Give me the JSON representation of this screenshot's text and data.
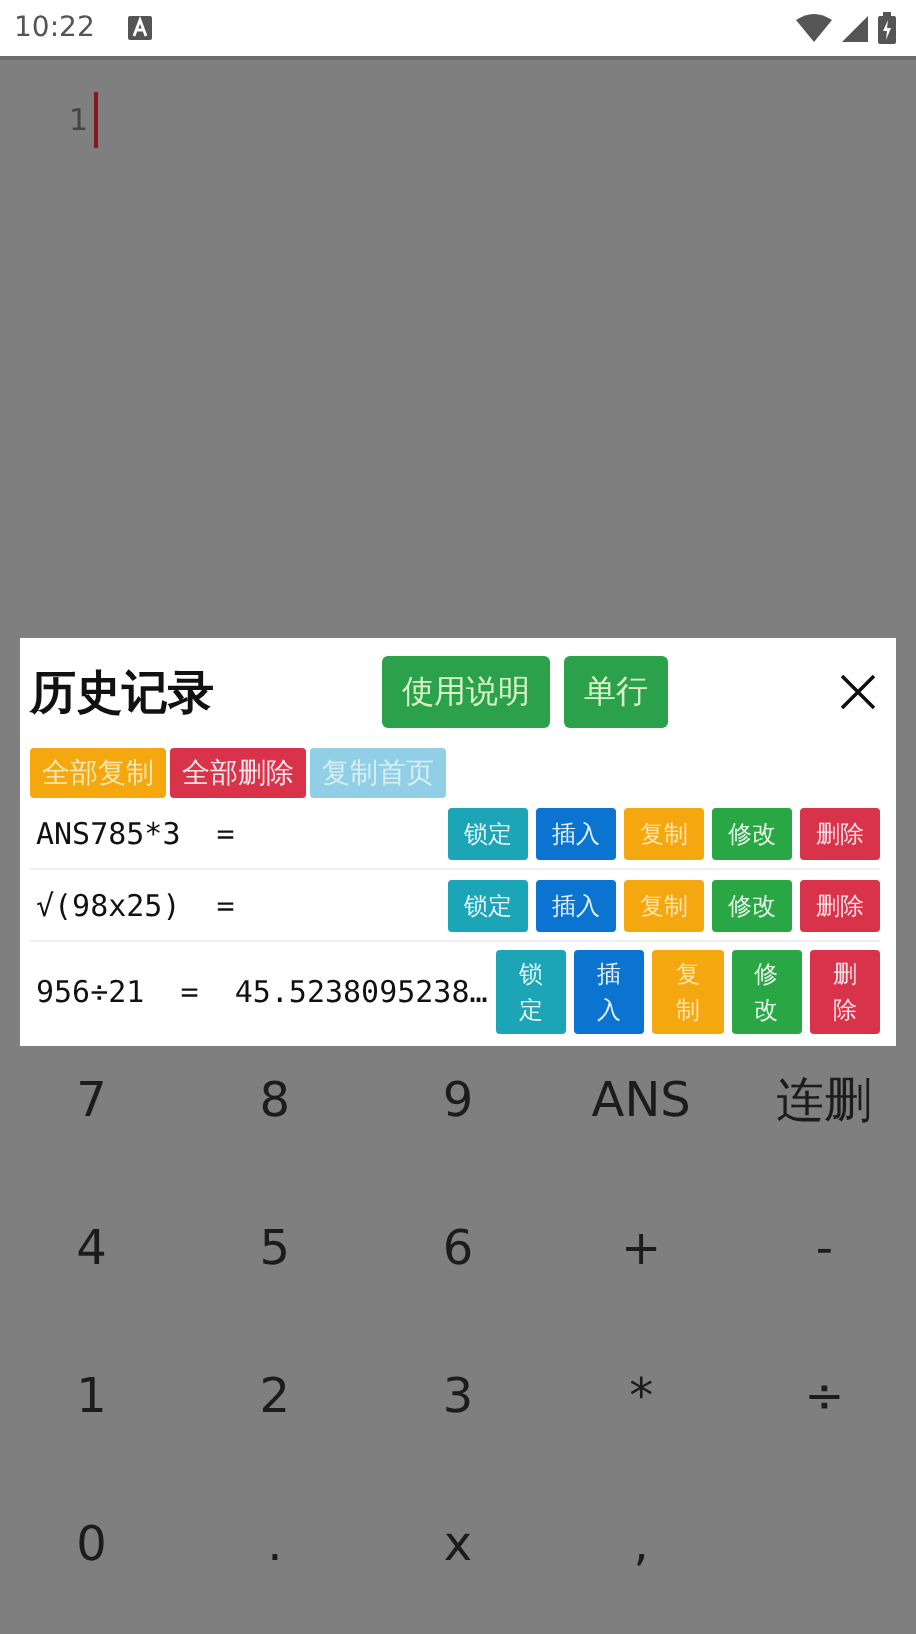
{
  "status_bar": {
    "time": "10:22"
  },
  "editor": {
    "line_number": "1"
  },
  "dialog": {
    "title": "历史记录",
    "header_buttons": [
      "使用说明",
      "单行"
    ],
    "toolbar": [
      {
        "label": "全部复制",
        "kind": "copy"
      },
      {
        "label": "全部删除",
        "kind": "delete"
      },
      {
        "label": "复制首页",
        "kind": "page"
      }
    ],
    "rows": [
      {
        "expression": "ANS785*3  =",
        "actions": [
          {
            "label": "锁定",
            "kind": "lock"
          },
          {
            "label": "插入",
            "kind": "insert"
          },
          {
            "label": "复制",
            "kind": "copy"
          },
          {
            "label": "修改",
            "kind": "edit"
          },
          {
            "label": "删除",
            "kind": "delete"
          }
        ]
      },
      {
        "expression": "√(98x25)  =",
        "actions": [
          {
            "label": "锁定",
            "kind": "lock"
          },
          {
            "label": "插入",
            "kind": "insert"
          },
          {
            "label": "复制",
            "kind": "copy"
          },
          {
            "label": "修改",
            "kind": "edit"
          },
          {
            "label": "删除",
            "kind": "delete"
          }
        ]
      },
      {
        "expression": "956÷21  =  45.5238095238…",
        "actions": [
          {
            "label": "锁定",
            "kind": "lock"
          },
          {
            "label": "插入",
            "kind": "insert"
          },
          {
            "label": "复制",
            "kind": "copy"
          },
          {
            "label": "修改",
            "kind": "edit"
          },
          {
            "label": "删除",
            "kind": "delete"
          }
        ]
      }
    ]
  },
  "keypad": [
    [
      "7",
      "8",
      "9",
      "ANS",
      "连删"
    ],
    [
      "4",
      "5",
      "6",
      "+",
      "-"
    ],
    [
      "1",
      "2",
      "3",
      "*",
      "÷"
    ],
    [
      "0",
      ".",
      "x",
      ","
    ]
  ]
}
